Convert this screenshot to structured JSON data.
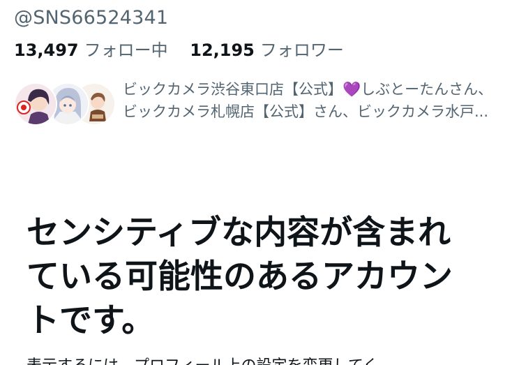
{
  "profile": {
    "handle": "@SNS66524341"
  },
  "stats": {
    "following_count": "13,497",
    "following_label": "フォロー中",
    "followers_count": "12,195",
    "followers_label": "フォロワー"
  },
  "followed_by": {
    "line1_prefix": "ビックカメラ渋谷東口店【公式】",
    "line1_emoji": "💜",
    "line1_suffix": "しぶとーたんさん、",
    "line2": "ビックカメラ札幌店【公式】さん、ビックカメラ水戸..."
  },
  "warning": {
    "title": "センシティブな内容が含まれている可能性のあるアカウントです。",
    "body": "表示するには、プロフィール上の設定を変更してく"
  },
  "colors": {
    "primary_text": "#0f1419",
    "secondary_text": "#536471",
    "background": "#ffffff"
  }
}
